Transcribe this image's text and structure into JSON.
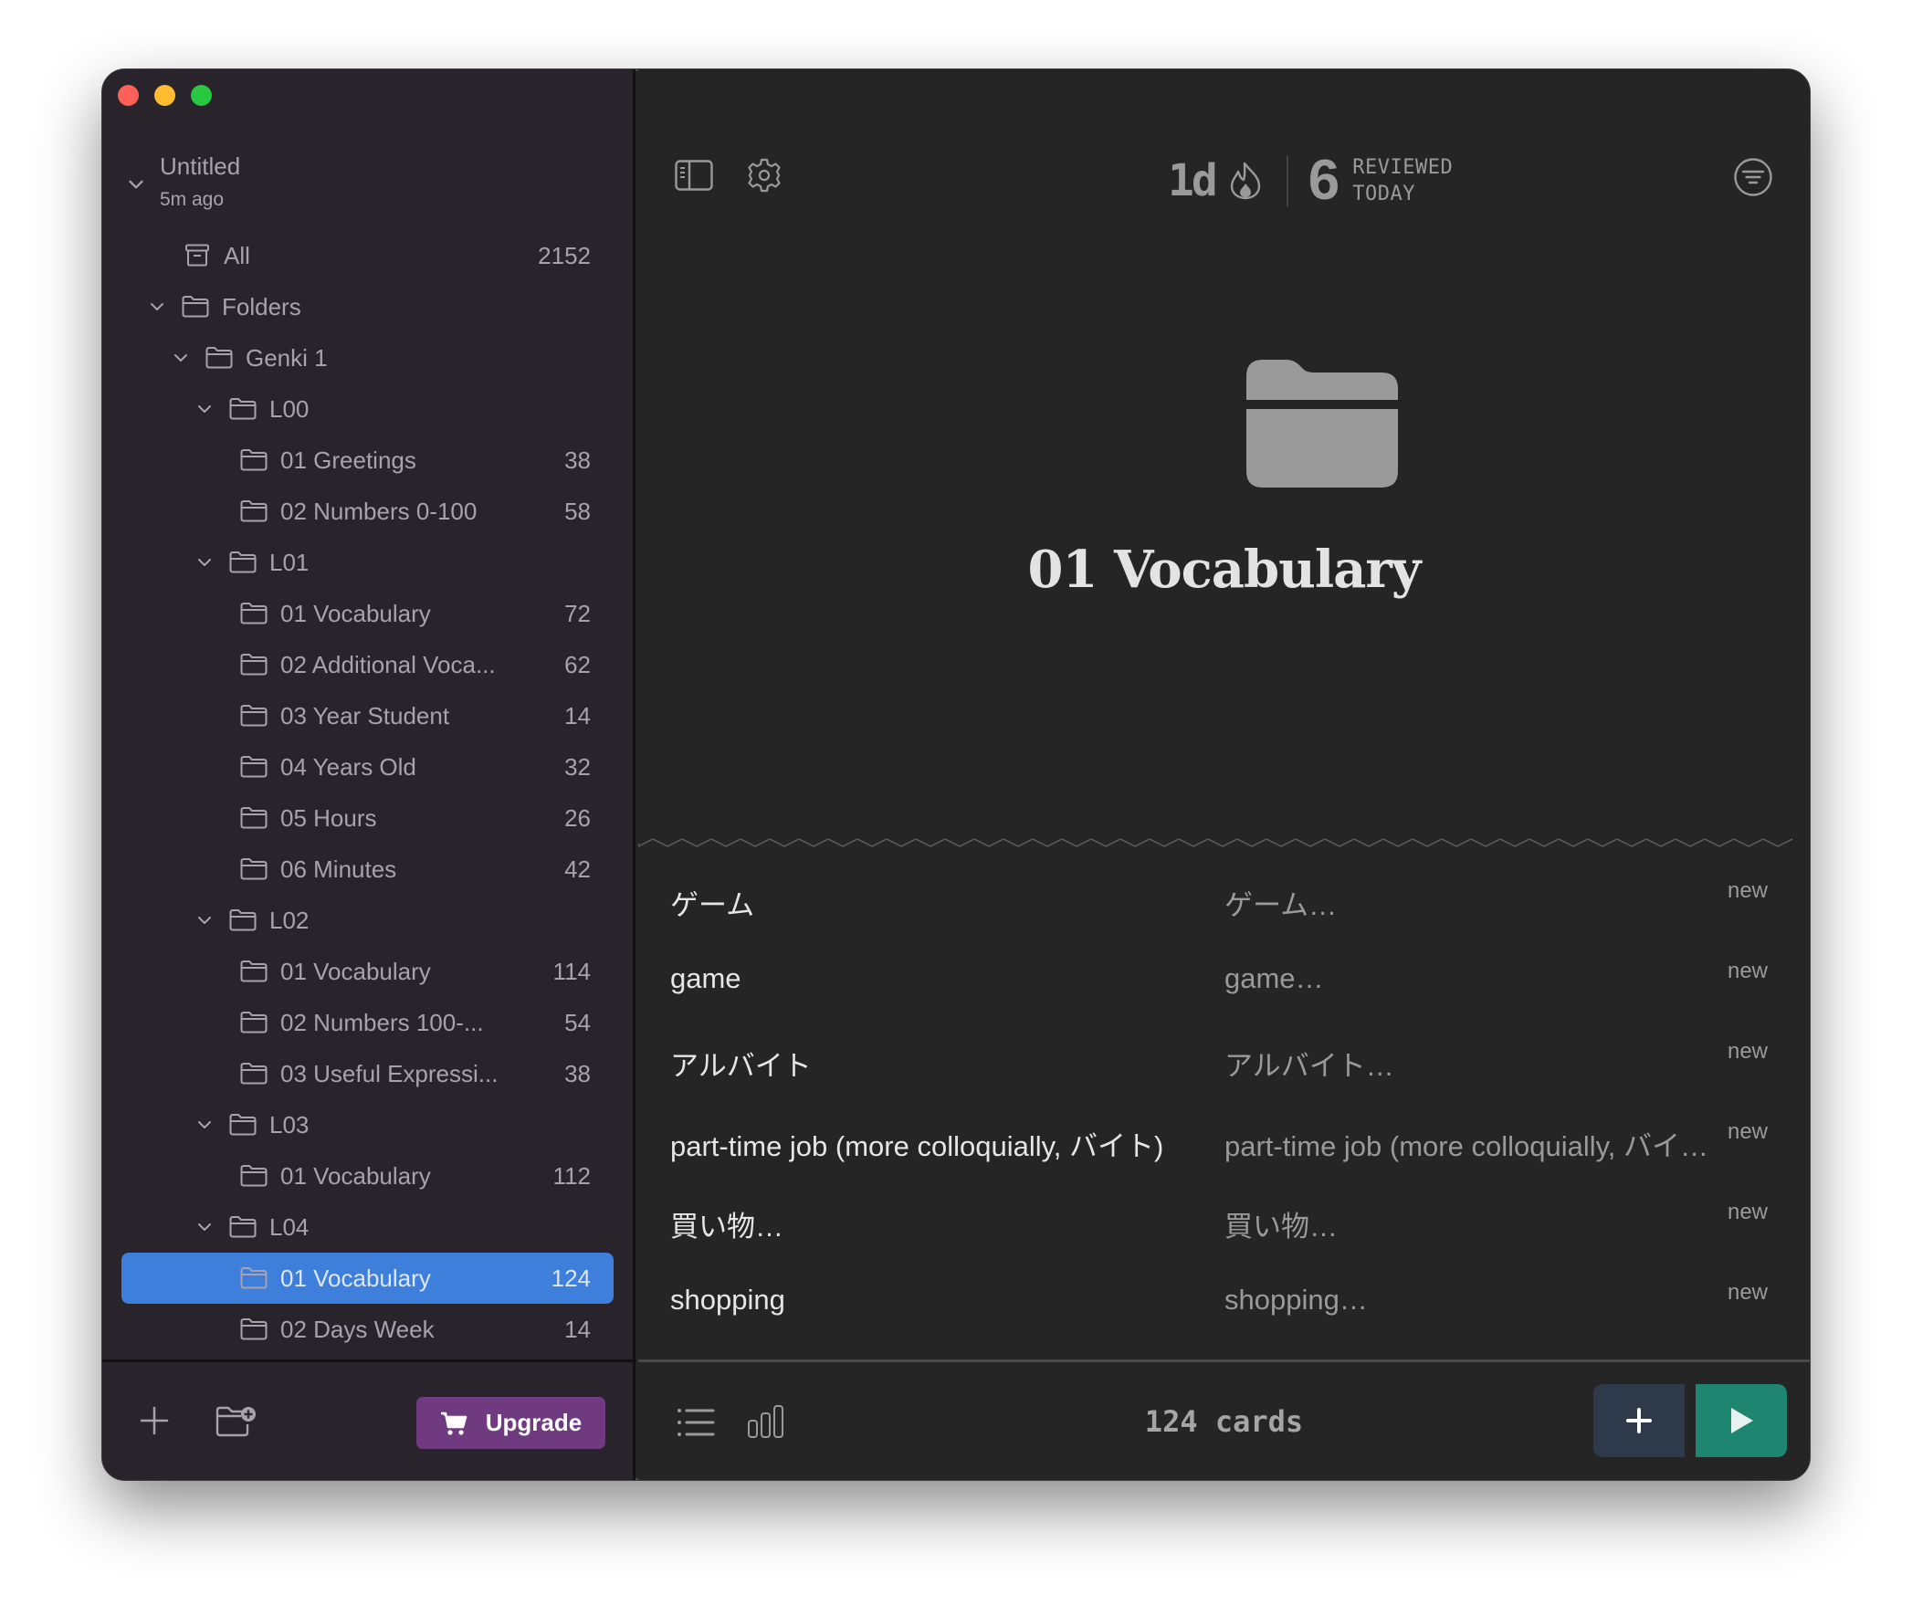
{
  "window": {
    "traffic_lights": [
      "close",
      "minimize",
      "zoom"
    ]
  },
  "sidebar": {
    "document": {
      "title": "Untitled",
      "subtitle": "5m ago"
    },
    "tree": [
      {
        "label": "All",
        "count": "2152",
        "icon": "archive-icon",
        "depth": 0,
        "chevron": false,
        "type": "all"
      },
      {
        "label": "Folders",
        "count": "",
        "icon": "folder-icon",
        "depth": 0,
        "chevron": true
      },
      {
        "label": "Genki 1",
        "count": "",
        "icon": "folder-icon",
        "depth": 1,
        "chevron": true
      },
      {
        "label": "L00",
        "count": "",
        "icon": "folder-icon",
        "depth": 2,
        "chevron": true
      },
      {
        "label": "01 Greetings",
        "count": "38",
        "icon": "folder-icon",
        "depth": 3,
        "chevron": false
      },
      {
        "label": "02 Numbers 0-100",
        "count": "58",
        "icon": "folder-icon",
        "depth": 3,
        "chevron": false
      },
      {
        "label": "L01",
        "count": "",
        "icon": "folder-icon",
        "depth": 2,
        "chevron": true
      },
      {
        "label": "01 Vocabulary",
        "count": "72",
        "icon": "folder-icon",
        "depth": 3,
        "chevron": false
      },
      {
        "label": "02 Additional Voca...",
        "count": "62",
        "icon": "folder-icon",
        "depth": 3,
        "chevron": false
      },
      {
        "label": "03 Year Student",
        "count": "14",
        "icon": "folder-icon",
        "depth": 3,
        "chevron": false
      },
      {
        "label": "04 Years Old",
        "count": "32",
        "icon": "folder-icon",
        "depth": 3,
        "chevron": false
      },
      {
        "label": "05 Hours",
        "count": "26",
        "icon": "folder-icon",
        "depth": 3,
        "chevron": false
      },
      {
        "label": "06 Minutes",
        "count": "42",
        "icon": "folder-icon",
        "depth": 3,
        "chevron": false
      },
      {
        "label": "L02",
        "count": "",
        "icon": "folder-icon",
        "depth": 2,
        "chevron": true
      },
      {
        "label": "01 Vocabulary",
        "count": "114",
        "icon": "folder-icon",
        "depth": 3,
        "chevron": false
      },
      {
        "label": "02 Numbers 100-...",
        "count": "54",
        "icon": "folder-icon",
        "depth": 3,
        "chevron": false
      },
      {
        "label": "03 Useful Expressi...",
        "count": "38",
        "icon": "folder-icon",
        "depth": 3,
        "chevron": false
      },
      {
        "label": "L03",
        "count": "",
        "icon": "folder-icon",
        "depth": 2,
        "chevron": true
      },
      {
        "label": "01 Vocabulary",
        "count": "112",
        "icon": "folder-icon",
        "depth": 3,
        "chevron": false
      },
      {
        "label": "L04",
        "count": "",
        "icon": "folder-icon",
        "depth": 2,
        "chevron": true
      },
      {
        "label": "01 Vocabulary",
        "count": "124",
        "icon": "folder-icon",
        "depth": 3,
        "chevron": false,
        "selected": true
      },
      {
        "label": "02 Days Week",
        "count": "14",
        "icon": "folder-icon",
        "depth": 3,
        "chevron": false
      }
    ],
    "footer": {
      "upgrade_label": "Upgrade",
      "upgrade_color": "#6f3a7f"
    },
    "selection_color": "#3f7fdc"
  },
  "header": {
    "streak": "1d",
    "reviewed_count": "6",
    "reviewed_label_line1": "REVIEWED",
    "reviewed_label_line2": "TODAY"
  },
  "deck": {
    "title": "01 Vocabulary",
    "card_count_label": "124 cards"
  },
  "cards": [
    {
      "front": "ゲーム",
      "back": "ゲーム…",
      "status": "new"
    },
    {
      "front": "game",
      "back": "game…",
      "status": "new"
    },
    {
      "front": "アルバイト",
      "back": "アルバイト…",
      "status": "new"
    },
    {
      "front": "part-time job (more colloquially, バイト)",
      "back": "part-time job (more colloquially, バイト…",
      "status": "new"
    },
    {
      "front": "買い物…",
      "back": "買い物…",
      "status": "new"
    },
    {
      "front": "shopping",
      "back": "shopping…",
      "status": "new"
    }
  ],
  "actions": {
    "add_color": "#2e3a49",
    "study_color": "#1e8570"
  }
}
